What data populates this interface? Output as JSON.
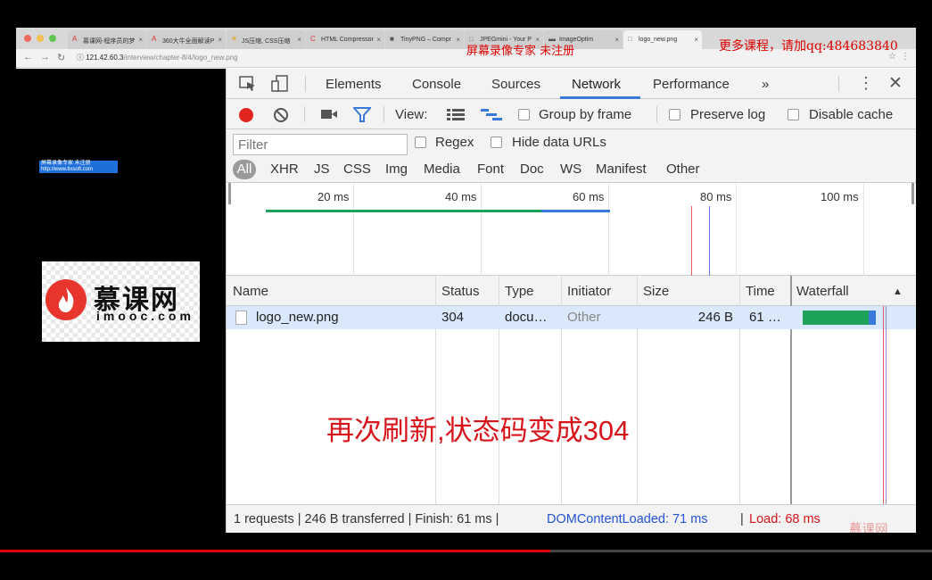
{
  "browser": {
    "tabs": [
      {
        "label": "慕课网-程序员的梦",
        "favicon": "A",
        "color": "#d33"
      },
      {
        "label": "360大牛全面解读P",
        "favicon": "A",
        "color": "#d33"
      },
      {
        "label": "JS压缩, CSS压缩",
        "favicon": "☀",
        "color": "#e8a000"
      },
      {
        "label": "HTML Compressor",
        "favicon": "C",
        "color": "#d33"
      },
      {
        "label": "TinyPNG – Compr",
        "favicon": "■",
        "color": "#555"
      },
      {
        "label": "JPEGmini - Your P",
        "favicon": "□",
        "color": "#777"
      },
      {
        "label": "ImageOptim",
        "favicon": "▬",
        "color": "#555"
      },
      {
        "label": "logo_new.png",
        "favicon": "□",
        "color": "#777"
      }
    ],
    "url_host": "121.42.60.3",
    "url_path": "/interview/chapter-8/4/logo_new.png"
  },
  "watermark": {
    "center": "屏幕录像专家  未注册",
    "right": "更多课程，请加qq:484683840",
    "box_line1": "屏幕录像专家      未注册",
    "box_line2": "http://www.tlxsoft.com"
  },
  "logo": {
    "cn": "慕课网",
    "en": "imooc.com"
  },
  "devtools": {
    "tabs": [
      "Elements",
      "Console",
      "Sources",
      "Network",
      "Performance",
      "»"
    ],
    "active_tab": "Network",
    "toolbar": {
      "view_label": "View:",
      "group_by_frame": "Group by frame",
      "preserve_log": "Preserve log",
      "disable_cache": "Disable cache"
    },
    "filter": {
      "placeholder": "Filter",
      "regex": "Regex",
      "hide_data_urls": "Hide data URLs"
    },
    "types": [
      "All",
      "XHR",
      "JS",
      "CSS",
      "Img",
      "Media",
      "Font",
      "Doc",
      "WS",
      "Manifest",
      "Other"
    ],
    "overview_ticks": [
      "20 ms",
      "40 ms",
      "60 ms",
      "80 ms",
      "100 ms"
    ],
    "columns": [
      "Name",
      "Status",
      "Type",
      "Initiator",
      "Size",
      "Time",
      "Waterfall"
    ],
    "rows": [
      {
        "name": "logo_new.png",
        "status": "304",
        "type": "docu…",
        "initiator": "Other",
        "size": "246 B",
        "time": "61 …"
      }
    ],
    "status_bar": {
      "summary": "1 requests | 246 B transferred | Finish: 61 ms |",
      "dom_content_loaded": "DOMContentLoaded: 71 ms",
      "sep": "|",
      "load": "Load: 68 ms",
      "brand": "慕课网"
    },
    "colors": {
      "accent": "#3879d9",
      "record": "#e0251f",
      "dcl": "#2454d6",
      "load": "#d8141b"
    }
  },
  "annotation": "再次刷新,状态码变成304",
  "video": {
    "progress_percent": 59
  }
}
